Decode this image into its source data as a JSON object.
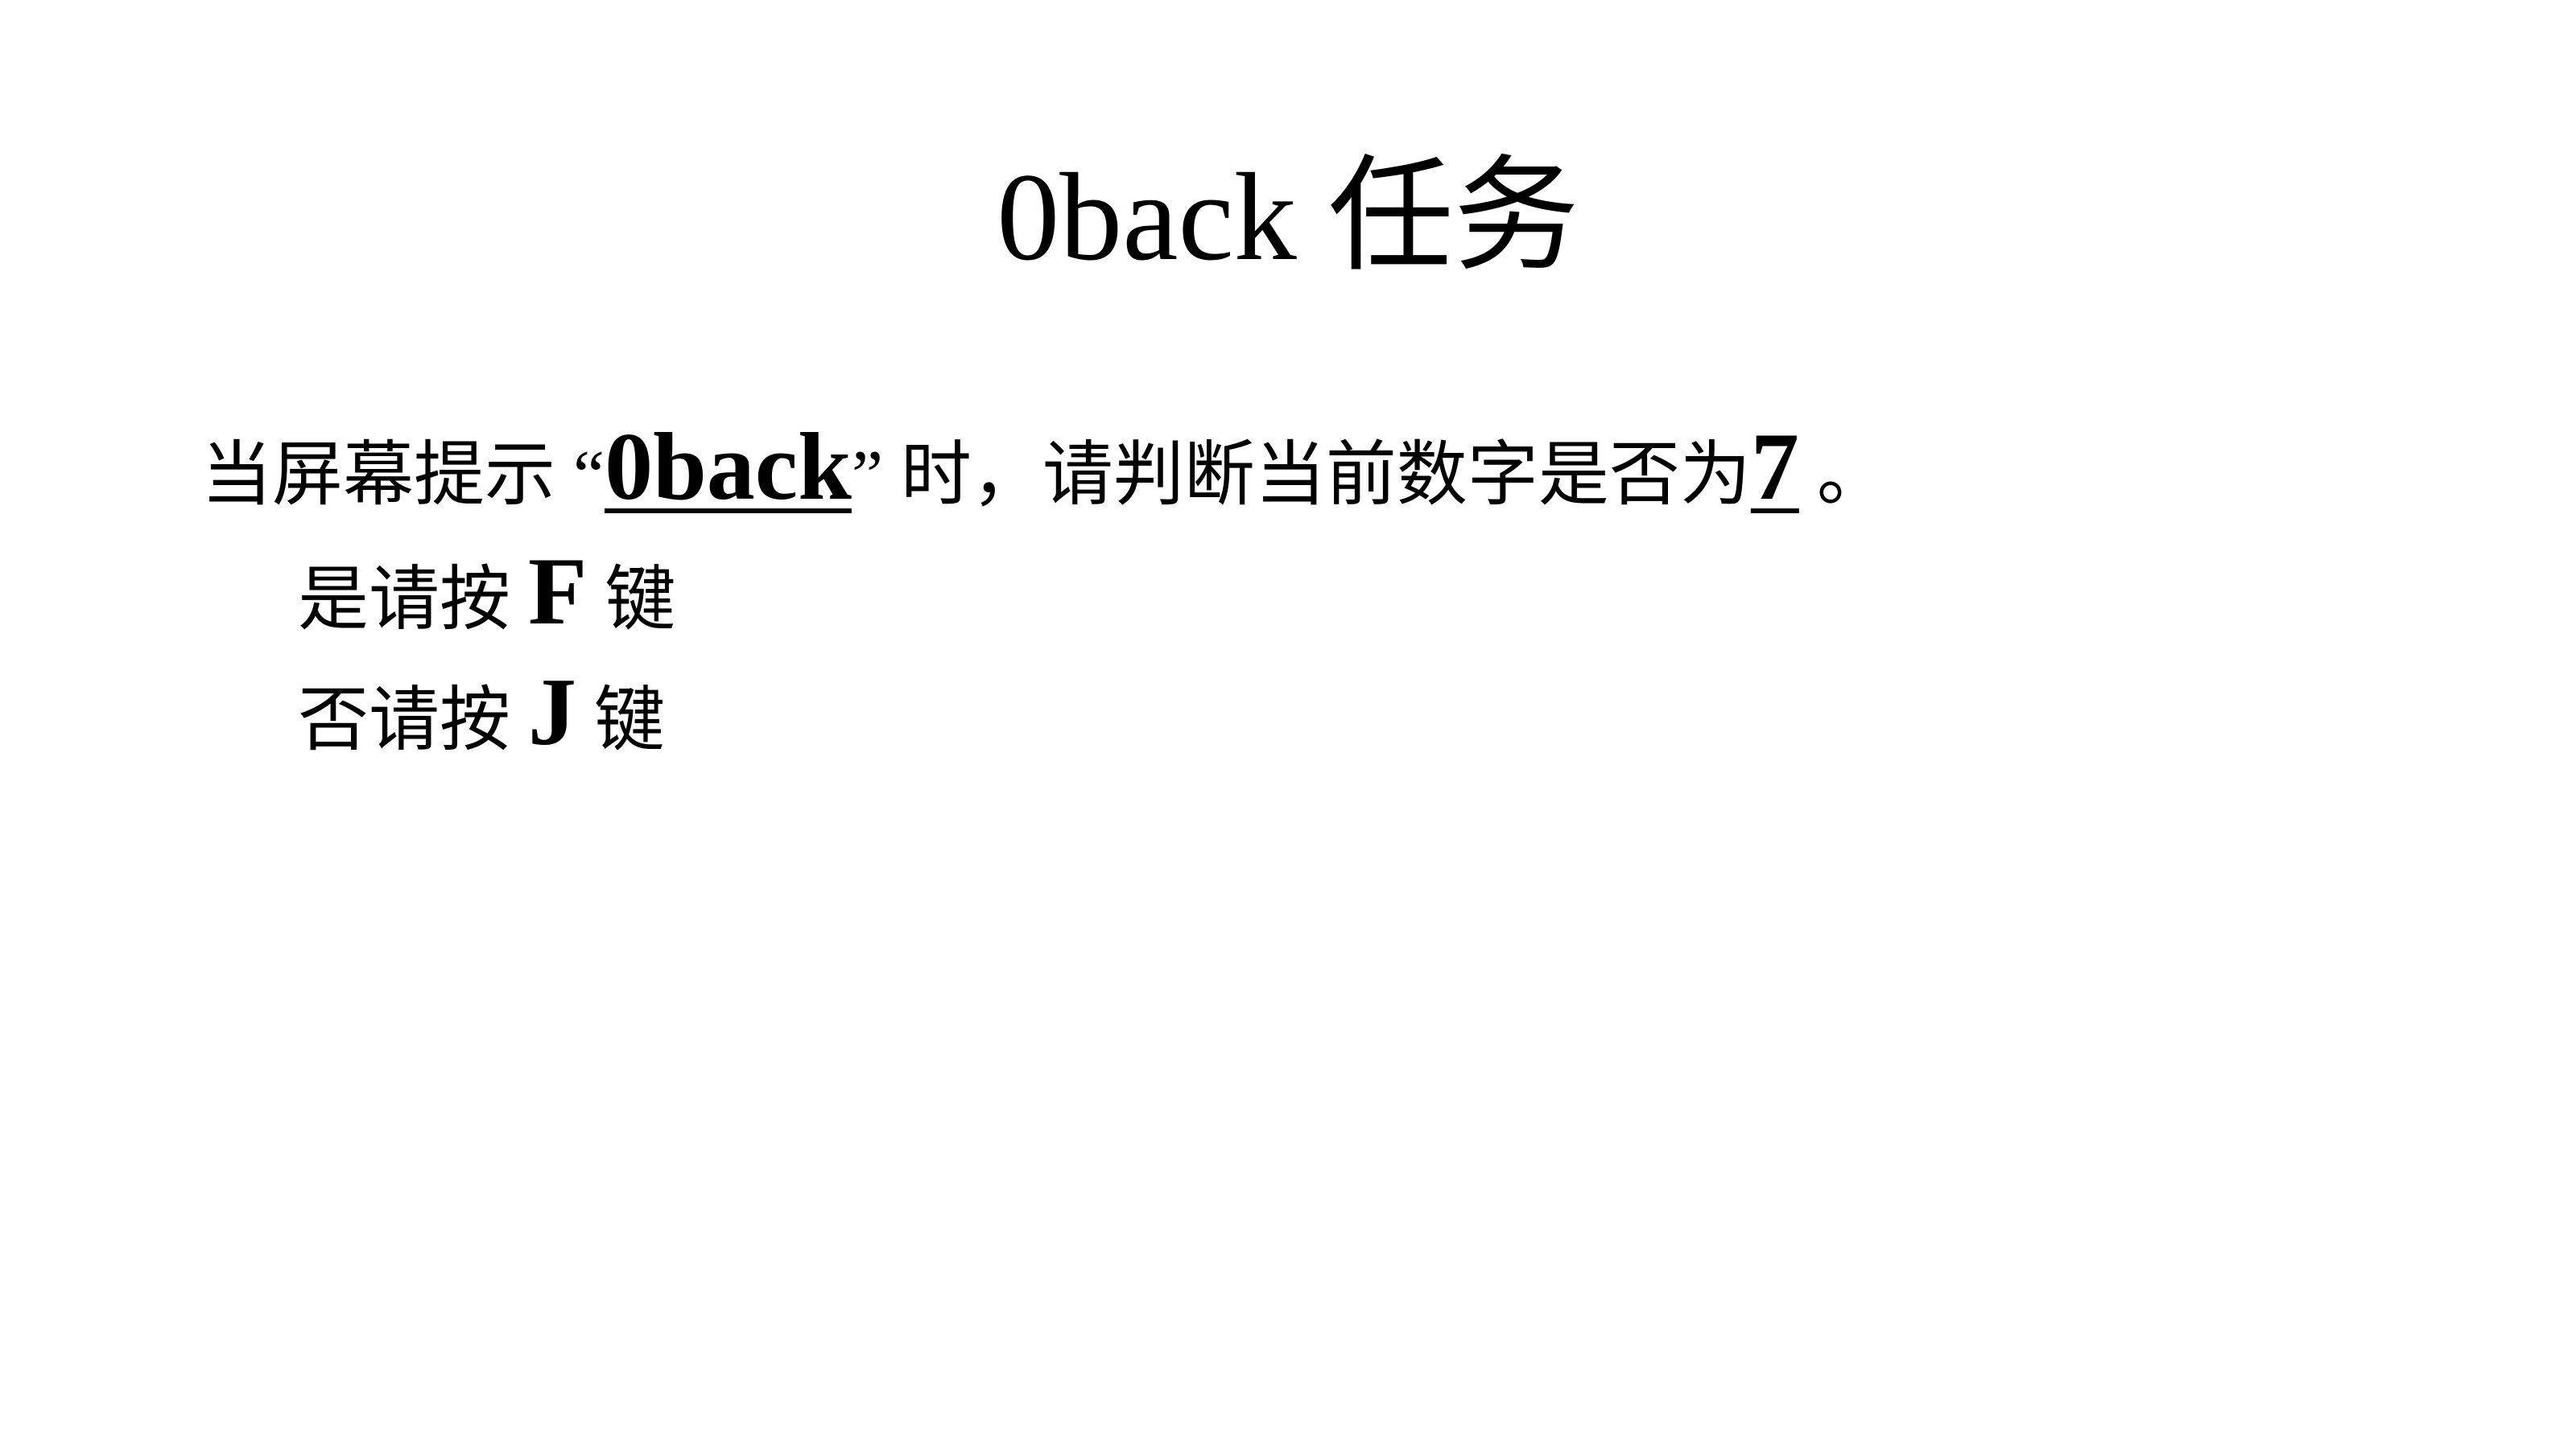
{
  "slide": {
    "title": "0back 任务",
    "instruction": {
      "prefix": "当屏幕提示 “",
      "keyword": "0back",
      "middle": "” 时，请判断当前数字是否为",
      "digit": "7",
      "suffix": " 。"
    },
    "yes_line": {
      "prefix": "是请按 ",
      "key": "F",
      "suffix": " 键"
    },
    "no_line": {
      "prefix": "否请按 ",
      "key": "J",
      "suffix": " 键"
    }
  }
}
